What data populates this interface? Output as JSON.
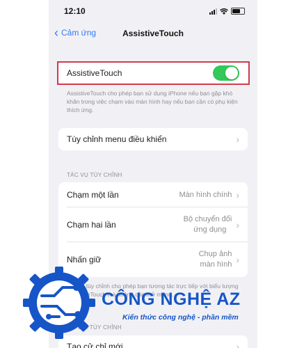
{
  "status_bar": {
    "time": "12:10"
  },
  "nav": {
    "back_label": "Cảm ứng",
    "title": "AssistiveTouch"
  },
  "assistive": {
    "label": "AssistiveTouch",
    "enabled": true
  },
  "description": "AssistiveTouch cho phép bạn sử dụng iPhone nếu bạn gặp khó khăn trong việc chạm vào màn hình hay nếu bạn cần có phụ kiện thích ứng.",
  "customize_menu": {
    "label": "Tùy chỉnh menu điều khiển"
  },
  "custom_actions": {
    "header": "TÁC VỤ TÙY CHỈNH",
    "rows": [
      {
        "label": "Chạm một lần",
        "value": "Màn hình chính"
      },
      {
        "label": "Chạm hai lần",
        "value_line1": "Bộ chuyển đổi",
        "value_line2": "ứng dụng"
      },
      {
        "label": "Nhấn giữ",
        "value_line1": "Chụp ảnh",
        "value_line2": "màn hình"
      }
    ],
    "footer": "Tác vụ tùy chỉnh cho phép bạn tương tác trực tiếp với biểu tượng AssistiveTouch mà không cần mở menu."
  },
  "custom_gestures": {
    "header": "CỬ CHỈ TÙY CHỈNH",
    "create_label": "Tạo cử chỉ mới"
  },
  "watermark": {
    "brand": "CÔNG NGHỆ AZ",
    "tagline": "Kiến thức công nghệ - phần mềm",
    "color": "#1655c7"
  }
}
